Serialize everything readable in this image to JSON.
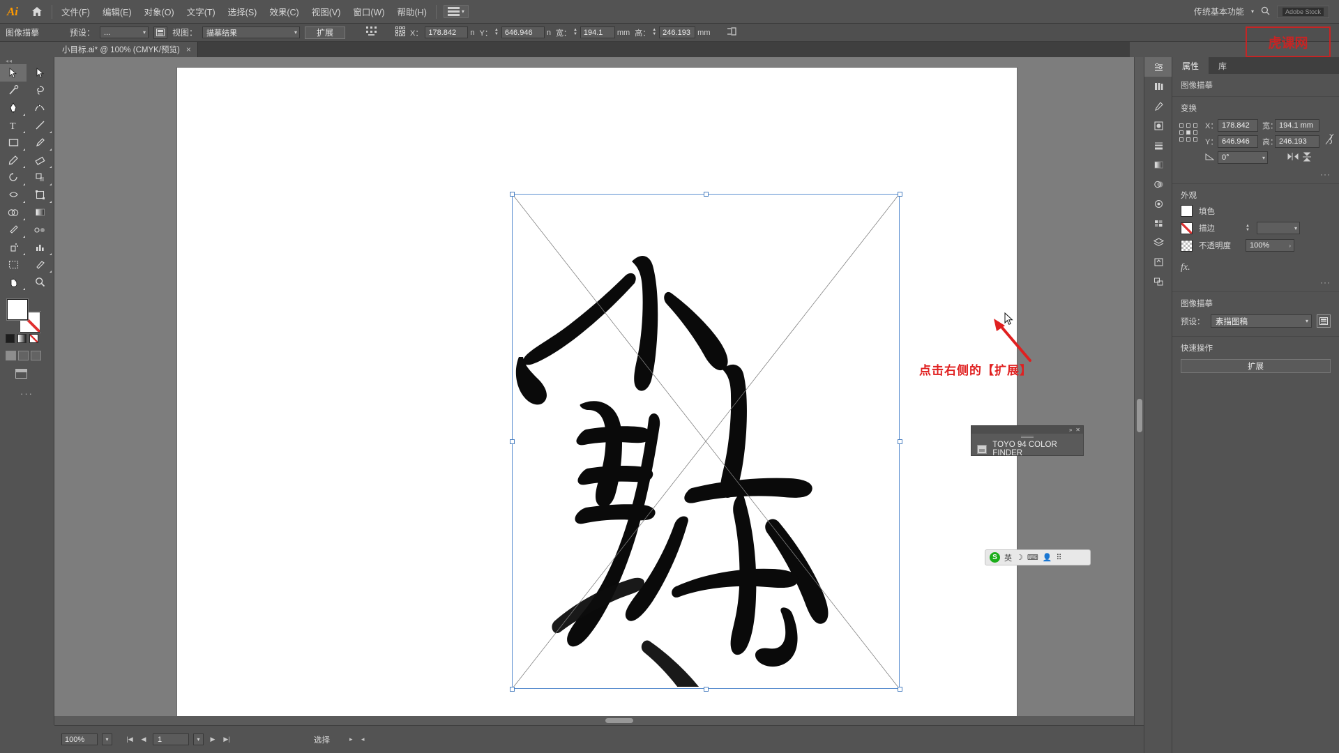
{
  "app": {
    "name": "Adobe Illustrator",
    "logo_text": "Ai"
  },
  "menubar": {
    "items": [
      {
        "label": "文件(F)"
      },
      {
        "label": "编辑(E)"
      },
      {
        "label": "对象(O)"
      },
      {
        "label": "文字(T)"
      },
      {
        "label": "选择(S)"
      },
      {
        "label": "效果(C)"
      },
      {
        "label": "视图(V)"
      },
      {
        "label": "窗口(W)"
      },
      {
        "label": "帮助(H)"
      }
    ],
    "workspace_name": "传统基本功能",
    "adobe_stock": "Adobe Stock",
    "search_label": "搜索"
  },
  "controlbar": {
    "title": "图像描摹",
    "preset_label": "预设：",
    "preset_value": "...",
    "view_label": "视图：",
    "view_value": "描摹结果",
    "expand_button": "扩展",
    "x_label": "X：",
    "x_value": "178.842",
    "x_unit": "n",
    "y_label": "Y：",
    "y_value": "646.946",
    "y_unit": "n",
    "w_label": "宽：",
    "w_value": "194.1",
    "w_unit": "mm",
    "h_label": "高：",
    "h_value": "246.193",
    "h_unit": "mm"
  },
  "tabs": [
    {
      "label": "小目标.ai* @ 100% (CMYK/预览)",
      "close": "×"
    }
  ],
  "toolbar": {
    "tools": [
      {
        "name": "selection-tool",
        "label": "选择工具"
      },
      {
        "name": "direct-selection-tool",
        "label": "直接选择工具"
      },
      {
        "name": "magic-wand-tool",
        "label": "魔棒工具"
      },
      {
        "name": "lasso-tool",
        "label": "套索工具"
      },
      {
        "name": "pen-tool",
        "label": "钢笔工具"
      },
      {
        "name": "curvature-tool",
        "label": "曲率工具"
      },
      {
        "name": "type-tool",
        "label": "文字工具"
      },
      {
        "name": "line-segment-tool",
        "label": "直线段工具"
      },
      {
        "name": "rectangle-tool",
        "label": "矩形工具"
      },
      {
        "name": "paintbrush-tool",
        "label": "画笔工具"
      },
      {
        "name": "pencil-tool",
        "label": "铅笔工具"
      },
      {
        "name": "eraser-tool",
        "label": "橡皮擦工具"
      },
      {
        "name": "rotate-tool",
        "label": "旋转工具"
      },
      {
        "name": "scale-tool",
        "label": "比例缩放工具"
      },
      {
        "name": "width-tool",
        "label": "宽度工具"
      },
      {
        "name": "free-transform-tool",
        "label": "自由变换工具"
      },
      {
        "name": "shape-builder-tool",
        "label": "形状生成器工具"
      },
      {
        "name": "gradient-tool",
        "label": "渐变工具"
      },
      {
        "name": "eyedropper-tool",
        "label": "吸管工具"
      },
      {
        "name": "blend-tool",
        "label": "混合工具"
      },
      {
        "name": "symbol-sprayer-tool",
        "label": "符号喷枪工具"
      },
      {
        "name": "column-graph-tool",
        "label": "柱形图工具"
      },
      {
        "name": "artboard-tool",
        "label": "画板工具"
      },
      {
        "name": "slice-tool",
        "label": "切片工具"
      },
      {
        "name": "hand-tool",
        "label": "抓手工具"
      },
      {
        "name": "zoom-tool",
        "label": "缩放工具"
      }
    ],
    "fill_color": "#ffffff",
    "stroke_color": "none",
    "more": "···"
  },
  "statusbar": {
    "zoom_value": "100%",
    "page_value": "1",
    "status_text": "选择"
  },
  "properties": {
    "tabs": [
      {
        "label": "属性"
      },
      {
        "label": "库"
      }
    ],
    "subtitle": "图像描摹",
    "transform": {
      "title": "变换",
      "x_label": "X：",
      "x_value": "178.842",
      "y_label": "Y：",
      "y_value": "646.946",
      "w_label": "宽：",
      "w_value": "194.1 mm",
      "h_label": "高：",
      "h_value": "246.193",
      "angle_value": "0°"
    },
    "appearance": {
      "title": "外观",
      "fill_label": "填色",
      "stroke_label": "描边",
      "stroke_weight": "",
      "opacity_label": "不透明度",
      "opacity_value": "100%",
      "fx_label": "fx."
    },
    "image_trace": {
      "title": "图像描摹",
      "preset_label": "预设：",
      "preset_value": "素描图稿"
    },
    "quick_actions": {
      "title": "快速操作",
      "expand_button": "扩展"
    },
    "more_dots": "···"
  },
  "annotation": {
    "text": "点击右侧的【扩展】",
    "color": "#e02020"
  },
  "toyo_panel": {
    "title": "TOYO 94 COLOR FINDER",
    "collapse": "»",
    "close": "✕"
  },
  "ime": {
    "logo": "S",
    "language": "英",
    "items": [
      "英",
      "☽",
      "⌨",
      "👤",
      "⠿"
    ]
  },
  "watermark": {
    "text": "虎课网"
  },
  "artwork": {
    "description": "小目标 书法毛笔字"
  }
}
